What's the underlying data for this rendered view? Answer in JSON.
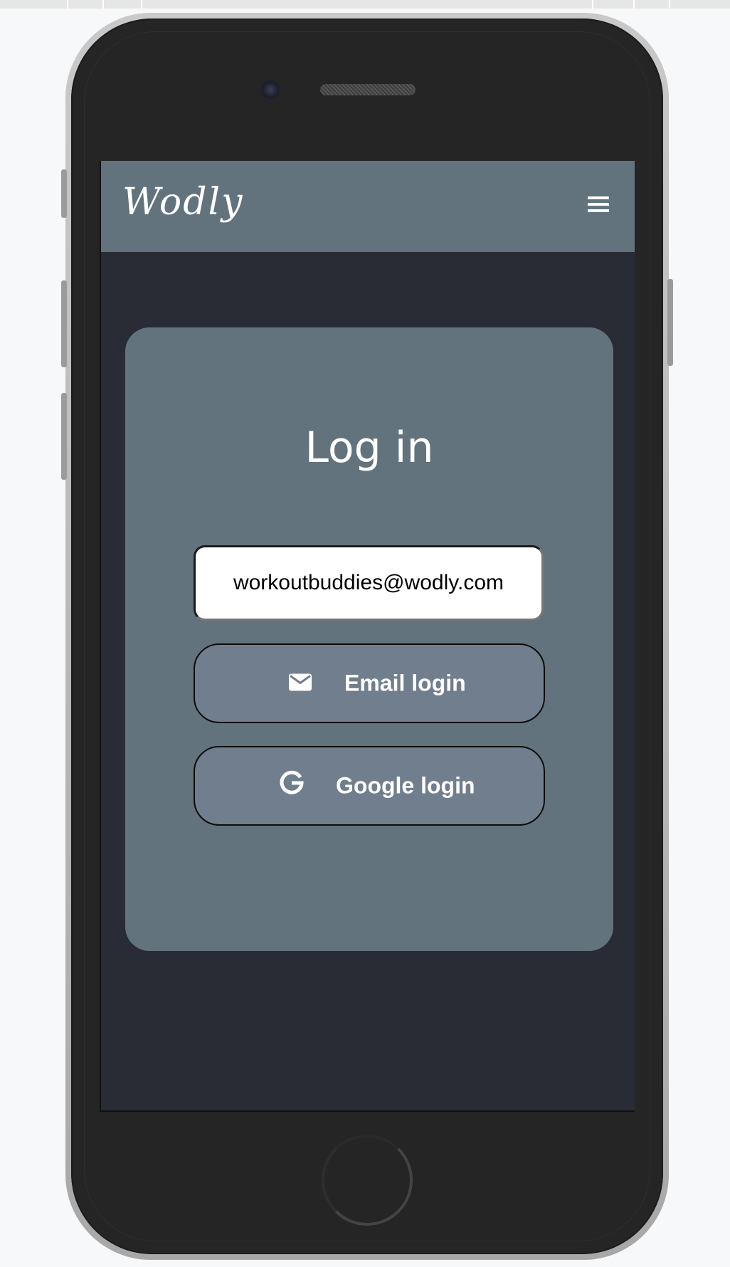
{
  "app": {
    "logo_text": "Wodly"
  },
  "login": {
    "title": "Log in",
    "email_value": "workoutbuddies@wodly.com",
    "email_button_label": "Email login",
    "google_button_label": "Google login"
  },
  "icons": {
    "menu": "hamburger-menu-icon",
    "email": "envelope-icon",
    "google": "google-g-icon"
  },
  "colors": {
    "navbar": "#63737d",
    "card": "#63737d",
    "screen_background": "#292c34",
    "button": "#707e8e",
    "text": "#ffffff"
  }
}
